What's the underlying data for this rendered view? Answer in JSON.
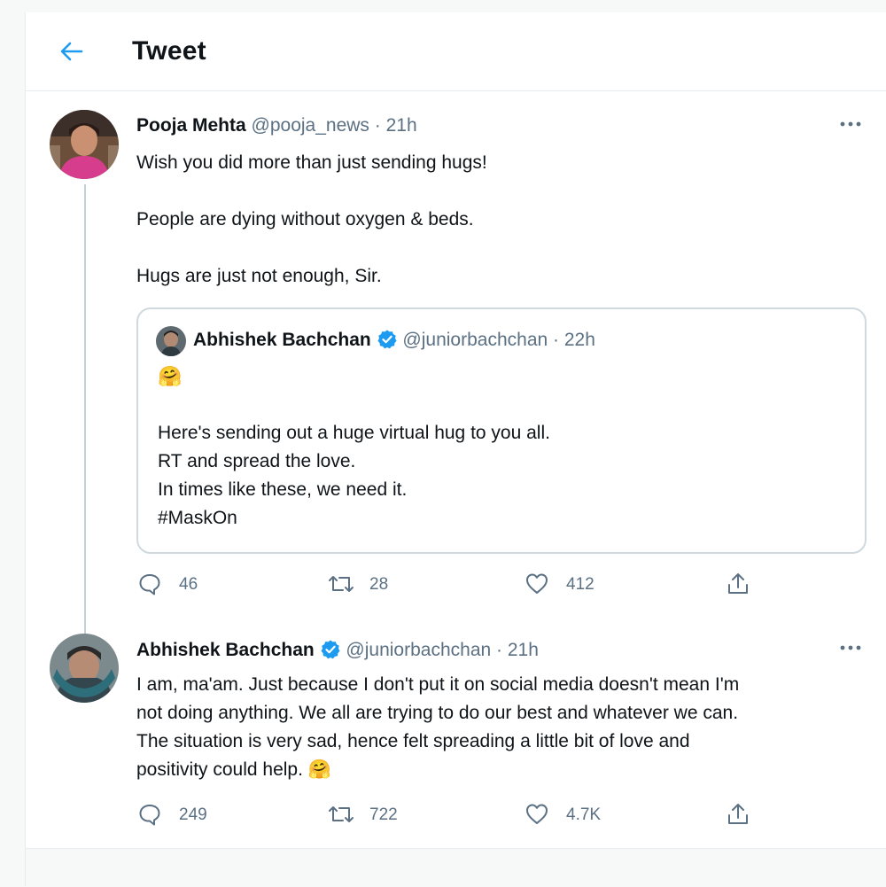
{
  "header": {
    "title": "Tweet"
  },
  "parent_tweet": {
    "display_name": "Pooja Mehta",
    "handle": "@pooja_news",
    "separator": "·",
    "time": "21h",
    "lines": [
      "Wish you did more than just sending hugs!",
      "People are dying without oxygen & beds.",
      "Hugs are just not enough, Sir."
    ],
    "quote": {
      "display_name": "Abhishek Bachchan",
      "verified": true,
      "handle": "@juniorbachchan",
      "separator": "·",
      "time": "22h",
      "emoji": "🤗",
      "lines": [
        "Here's sending out a huge virtual hug to you all.",
        "RT and spread the love.",
        "In times like these, we need it.",
        "#MaskOn"
      ]
    },
    "actions": {
      "replies": "46",
      "retweets": "28",
      "likes": "412"
    }
  },
  "reply_tweet": {
    "display_name": "Abhishek Bachchan",
    "verified": true,
    "handle": "@juniorbachchan",
    "separator": "·",
    "time": "21h",
    "lines": [
      "I am, ma'am. Just because I don't put it on social media doesn't mean I'm",
      "not doing anything. We all are trying to do our best and whatever we can.",
      "The situation is very sad, hence felt spreading a little bit of love and",
      "positivity could help."
    ],
    "emoji": "🤗",
    "actions": {
      "replies": "249",
      "retweets": "722",
      "likes": "4.7K"
    }
  },
  "icons": {
    "back": "back-arrow-icon",
    "more": "more-options-icon",
    "verified": "verified-badge-icon",
    "reply": "reply-icon",
    "retweet": "retweet-icon",
    "like": "heart-icon",
    "share": "share-icon"
  },
  "colors": {
    "accent": "#1d9bf0",
    "text": "#0f1419",
    "secondary_text": "#5b7083",
    "border": "#cfd9de",
    "page_background": "#f7f9f9"
  }
}
